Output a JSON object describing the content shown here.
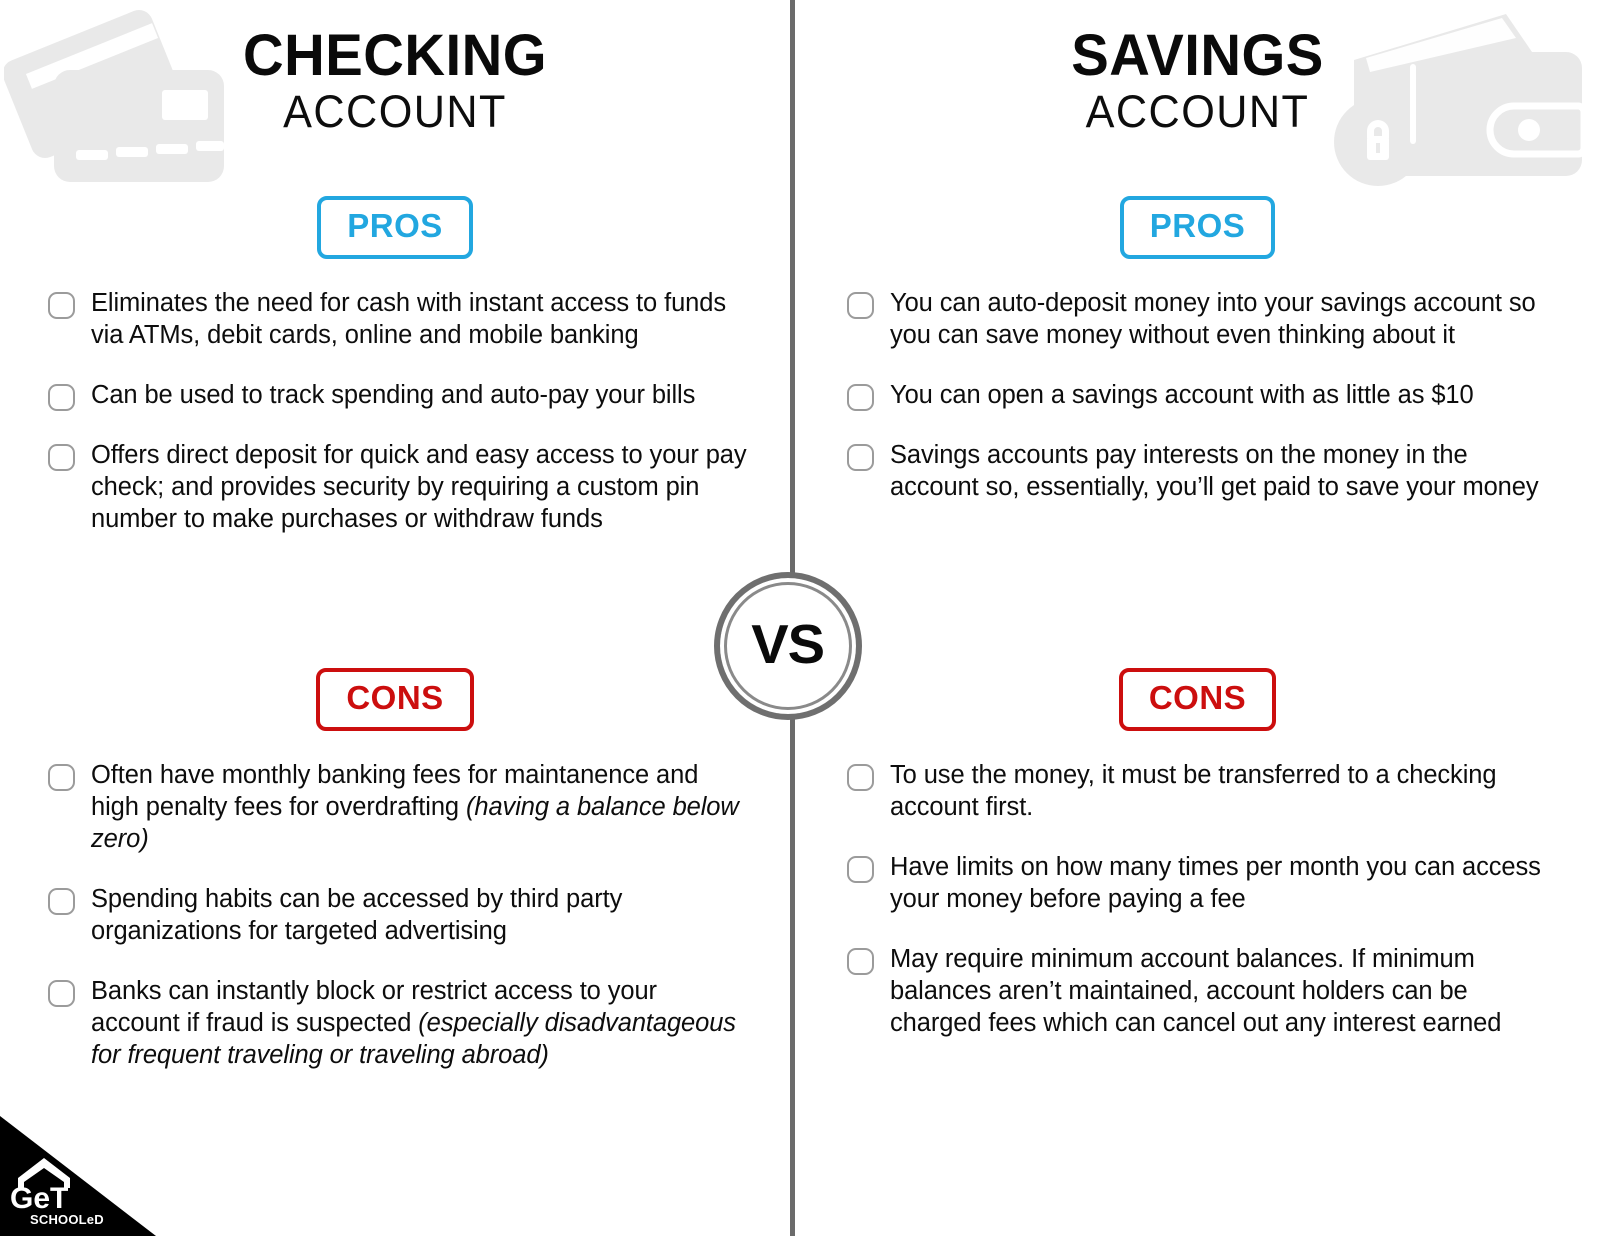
{
  "center": {
    "vs_label": "VS",
    "divider_color": "#6b6b6b",
    "ring_color": "#6f6f6f"
  },
  "colors": {
    "pros_accent": "#22a7e0",
    "cons_accent": "#cc0e0e",
    "text": "#0d0d0d",
    "decor_gray": "#e9e9e9",
    "checkbox_border": "#9b9b9b"
  },
  "left": {
    "icon_name": "credit-cards-icon",
    "title_main": "CHECKING",
    "title_sub": "ACCOUNT",
    "pros_label": "PROS",
    "cons_label": "CONS",
    "pros": [
      "Eliminates the need for cash with instant access to funds via ATMs, debit cards, online and mobile banking",
      "Can be used to track spending and auto-pay your bills",
      "Offers direct deposit for quick and easy access to your pay check; and provides security by requiring a custom pin number to make purchases or withdraw funds"
    ],
    "cons": [
      {
        "text": "Often have monthly banking fees for maintanence and high penalty fees for overdrafting ",
        "italic": "(having a balance below zero)"
      },
      {
        "text": "Spending habits can be accessed by third party organizations for targeted advertising",
        "italic": ""
      },
      {
        "text": "Banks can instantly block or restrict access to your account if fraud is suspected ",
        "italic": "(especially disadvantageous for frequent traveling or traveling abroad)"
      }
    ]
  },
  "right": {
    "icon_name": "wallet-lock-icon",
    "title_main": "SAVINGS",
    "title_sub": "ACCOUNT",
    "pros_label": "PROS",
    "cons_label": "CONS",
    "pros": [
      "You can auto-deposit money into your savings account so you can save money without even thinking about it",
      "You can open a savings account with as little as $10",
      "Savings accounts pay interests on the money in the account so, essentially, you’ll get paid to save your money"
    ],
    "cons": [
      {
        "text": "To use the money, it must be transferred to a checking account first.",
        "italic": ""
      },
      {
        "text": "Have limits on how many times per month you can access your money before paying a fee",
        "italic": ""
      },
      {
        "text": "May require minimum account balances. If minimum balances aren’t maintained, account holders can be charged fees which can cancel out any interest earned",
        "italic": ""
      }
    ]
  },
  "logo": {
    "name": "get-schooled-logo",
    "line1": "GeT",
    "line2": "SCHOOLeD"
  }
}
